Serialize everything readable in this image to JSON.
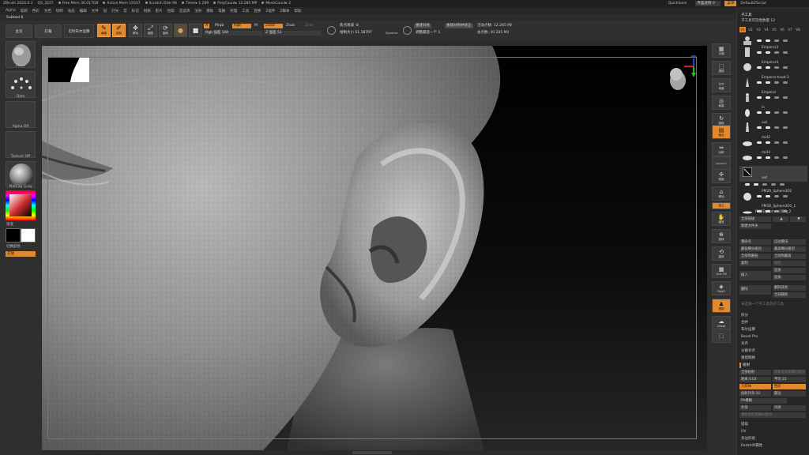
{
  "titlebar": {
    "items": [
      "ZBrush 2024.0.1",
      "QS_3227",
      "Free Mem 36.017GB",
      "Active Mem 19337",
      "Scratch Disk 98",
      "Timer▸ 1.269",
      "PolyCount▸ 12.285 MP",
      "MeshCount▸ 2"
    ],
    "quicksave": "QuickSave",
    "transparency": "界面透明 0",
    "menus_btn": "菜单",
    "script": "DefaultZScript"
  },
  "menubar": {
    "items": [
      "Alpha",
      "笔刷",
      "色彩",
      "文档",
      "绘制",
      "动态",
      "编辑",
      "文件",
      "层",
      "灯光",
      "宏",
      "标记",
      "材质",
      "影片",
      "拾取",
      "首选项",
      "渲染",
      "模板",
      "笔触",
      "纹理",
      "工具",
      "变换",
      "Z插件",
      "Z脚本",
      "帮助"
    ]
  },
  "subtool_label": "Subtool 6",
  "toolbar": {
    "home": "主页",
    "lightbox": "灯箱",
    "live_boolean": "实时布尔运算",
    "edit": "编辑",
    "draw": "绘制",
    "move": "移动",
    "scale": "缩放",
    "rotate": "旋转",
    "a_label": "A",
    "mrgb": "Mrgb",
    "rgb": "Rgb",
    "m": "M",
    "zadd": "Zadd",
    "zsub": "Zsub",
    "zcut": "Zcut",
    "rgb_intensity": "Rgb 强度 100",
    "rgb_intensity_value": 100,
    "z_intensity": "Z 强度 51",
    "z_intensity_value": 51,
    "focal_shift": "焦点衰减 -8",
    "draw_size": "绘制大小 51.18797",
    "dynamic": "Dynamic",
    "active_points": "活动点数: 12.285 Mil",
    "total_points": "总点数: 30.205 Mil",
    "resym": "重建对称",
    "resym_fixed": "重建对称并修正",
    "adjust_last": "调整最后一个 1"
  },
  "leftshelf": {
    "brush": "Move",
    "stroke": "Dots",
    "alpha": "Alpha Off",
    "texture": "Texture Off",
    "material": "MatCap Gray",
    "gradient": "渐变",
    "switch_color": "切换颜色",
    "alternate": "交替"
  },
  "righttools": {
    "items": [
      "平铺",
      "透视",
      "地面",
      "局部",
      "旋转",
      "聚合",
      "对称",
      "Dynamic",
      "框架",
      "移动",
      "缩放",
      "旋转",
      "Line Fill",
      "PolyF",
      "透明",
      "Ghost",
      "独立"
    ]
  },
  "rpanel": {
    "header": "子工具",
    "count": "子工具可见性数量 12",
    "tabs": [
      "V1",
      "V2",
      "V3",
      "V4",
      "V5",
      "V6",
      "V7",
      "V8"
    ],
    "subtools": [
      "",
      "Emperor3",
      "Emperor4",
      "Emperor-head-3",
      "Emperor",
      "in",
      "out",
      "mid2",
      "mid3",
      "out",
      "PM3D_Sphere3D2",
      "PM3D_Sphere3D1_1",
      "PM3D_Sphere3D1_2"
    ],
    "btn_all_low": "全部低级",
    "btn_arrow_up": "▲",
    "btn_arrow_down": "▼",
    "btn_new_folder": "新建文件夹",
    "rename": "重命名",
    "auto_reorder": "自动重排",
    "all_low": "最低细分级别",
    "all_high": "最高细分级别",
    "all_to_low": "全部到最低",
    "all_to_high": "全部到最高",
    "copy": "复制",
    "paste": "粘贴",
    "insert_top": "插入",
    "append": "追加",
    "delete": "删除",
    "delete_others": "删除其他",
    "delete_all": "全部删除",
    "merge_down": "向下合并",
    "merge_note": "未选择一个子工具到子工具",
    "split": "拆分",
    "merge": "合并",
    "boolean": "布尔运算",
    "bevel": "Bevel Pro",
    "align": "对齐",
    "distribute": "分散对齐",
    "remesh": "重建网格",
    "project": "投射",
    "project_all": "全部投射",
    "dist": "距离 0.02",
    "mean": "平均 25",
    "pa_blur": "PA模糊",
    "farthest": "最远",
    "projection_shell": "投射外壳 10",
    "inner": "内部",
    "outer": "外部",
    "extract": "提取",
    "geometry": "几何体",
    "color": "色彩",
    "extract_note": "重新投射高细分级别",
    "project_bpr": "投影BPR",
    "uv": "UV",
    "polygroups": "多边形组",
    "flip_normals": "翻转法线",
    "gizmo": "Redshift属性"
  }
}
